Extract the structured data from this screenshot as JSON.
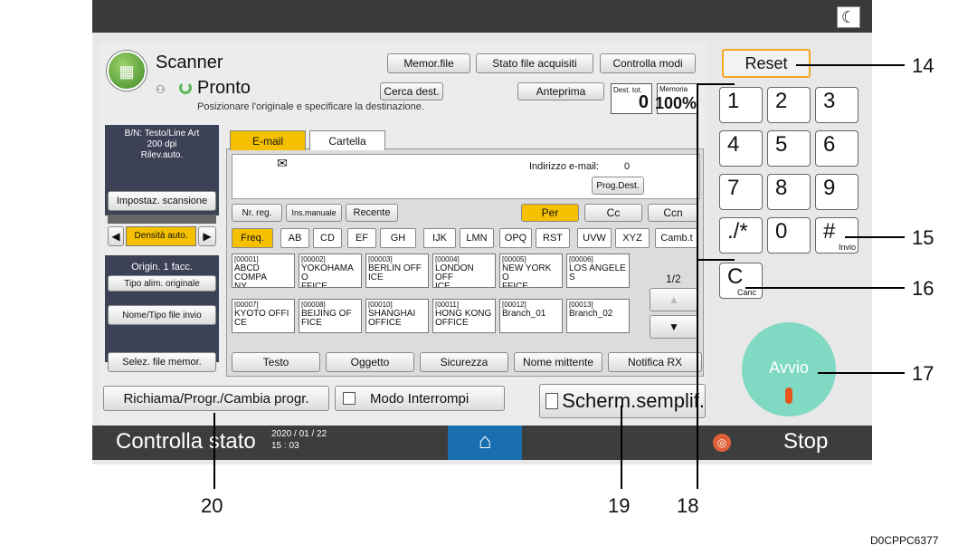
{
  "topbar": {
    "moon_icon": "moon-icon"
  },
  "app": {
    "title": "Scanner",
    "status": "Pronto",
    "instruction": "Posizionare l'originale e specificare la destinazione."
  },
  "header_buttons": {
    "memor_file": "Memor.file",
    "stato_file": "Stato file acquisiti",
    "controlla_modi": "Controlla modi"
  },
  "reset": "Reset",
  "row2": {
    "cerca_dest": "Cerca dest.",
    "anteprima": "Anteprima",
    "dest_tot_label": "Dest. tot.",
    "dest_tot_value": "0",
    "memoria_label": "Memoria",
    "memoria_value": "100%"
  },
  "left_panel": {
    "settings": "B/N: Testo/Line Art\n200 dpi\nRilev.auto.",
    "impostaz": "Impostaz. scansione",
    "densita": "Densità auto.",
    "origin": "Origin. 1 facc.",
    "tipo_alim": "Tipo alim. originale",
    "nome_tipo": "Nome/Tipo file invio",
    "selez_file": "Selez. file memor."
  },
  "tabs": {
    "email": "E-mail",
    "cartella": "Cartella"
  },
  "email_area": {
    "indirizzo": "Indirizzo e-mail:",
    "count": "0",
    "prog_dest": "Prog.Dest."
  },
  "reg_buttons": {
    "nr_reg": "Nr. reg.",
    "ins_manuale": "Ins.manuale",
    "recente": "Recente"
  },
  "dest_type": {
    "per": "Per",
    "cc": "Cc",
    "ccn": "Ccn"
  },
  "alpha_tabs": [
    "Freq.",
    "AB",
    "CD",
    "EF",
    "GH",
    "IJK",
    "LMN",
    "OPQ",
    "RST",
    "UVW",
    "XYZ",
    "Camb.t"
  ],
  "dest_row1": [
    {
      "code": "[00001]",
      "name": "ABCD COMPA\nNY"
    },
    {
      "code": "[00002]",
      "name": "YOKOHAMA O\nFFICE"
    },
    {
      "code": "[00003]",
      "name": "BERLIN OFF\nICE"
    },
    {
      "code": "[00004]",
      "name": "LONDON OFF\nICE"
    },
    {
      "code": "[00005]",
      "name": "NEW YORK O\nFFICE"
    },
    {
      "code": "[00006]",
      "name": "LOS ANGELE\nS"
    }
  ],
  "dest_row2": [
    {
      "code": "[00007]",
      "name": "KYOTO OFFI\nCE"
    },
    {
      "code": "[00008]",
      "name": "BEIJING OF\nFICE"
    },
    {
      "code": "[00010]",
      "name": "SHANGHAI\nOFFICE"
    },
    {
      "code": "[00011]",
      "name": "HONG KONG\nOFFICE"
    },
    {
      "code": "[00012]",
      "name": "Branch_01"
    },
    {
      "code": "[00013]",
      "name": "Branch_02"
    }
  ],
  "page_indicator": "1/2",
  "bottom_tabs": [
    "Testo",
    "Oggetto",
    "Sicurezza",
    "Nome mittente",
    "Notifica RX"
  ],
  "richiama": "Richiama/Progr./Cambia progr.",
  "modo_interrompi": "Modo Interrompi",
  "scherm": "Scherm.semplif.",
  "status_bar": {
    "controlla_stato": "Controlla stato",
    "date": "2020 / 01 / 22",
    "time": "15 : 03",
    "stop": "Stop"
  },
  "keypad": [
    "1",
    "2",
    "3",
    "4",
    "5",
    "6",
    "7",
    "8",
    "9",
    "./*",
    "0",
    "#"
  ],
  "keypad_sub": {
    "invio": "Invio",
    "canc": "Canc",
    "clear": "C"
  },
  "avvio": "Avvio",
  "callouts": [
    "14",
    "15",
    "16",
    "17",
    "18",
    "19",
    "20"
  ],
  "image_code": "D0CPPC6377",
  "colors": {
    "accent_orange": "#f5a623",
    "status_bar": "#3d3d3d",
    "avvio_green": "#7fd9c3",
    "header_bg": "#e9e9e9"
  }
}
